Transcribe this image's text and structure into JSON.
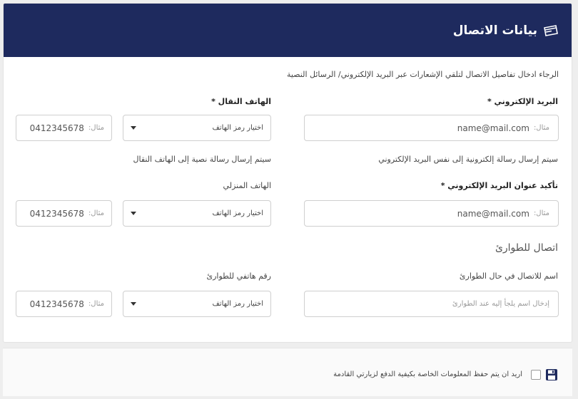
{
  "header": {
    "title": "بيانات الاتصال",
    "icon": "card-icon"
  },
  "intro": "الرجاء ادخال تفاصيل الاتصال لتلقي الإشعارات عبر البريد الإلكتروني/ الرسائل النصية",
  "email": {
    "label": "البريد الإلكتروني *",
    "placeholder_prefix": "مثال:",
    "placeholder_value": "name@mail.com",
    "hint": "سيتم إرسال رسالة إلكترونية إلى نفس البريد الإلكتروني"
  },
  "confirm_email": {
    "label": "تأكيد عنوان البريد الإلكتروني *",
    "placeholder_prefix": "مثال:",
    "placeholder_value": "name@mail.com"
  },
  "mobile": {
    "label": "الهاتف النقال *",
    "select_label": "اختيار رمز الهاتف",
    "placeholder_prefix": "مثال:",
    "placeholder_value": "0412345678",
    "hint": "سيتم إرسال رسالة نصية إلى الهاتف النقال"
  },
  "home_phone": {
    "label": "الهاتف المنزلي",
    "select_label": "اختيار رمز الهاتف",
    "placeholder_prefix": "مثال:",
    "placeholder_value": "0412345678"
  },
  "emergency": {
    "section_title": "اتصال للطوارئ",
    "name_label": "اسم للاتصال في حال الطوارئ",
    "name_placeholder": "إدخال اسم يلجأ إليه عند الطوارئ",
    "phone_label": "رقم هاتفي للطوارئ",
    "select_label": "اختيار رمز الهاتف",
    "placeholder_prefix": "مثال:",
    "placeholder_value": "0412345678"
  },
  "footer": {
    "save_text": "اريد ان يتم حفظ المعلومات الخاصة بكيفية الدفع لزيارتي القادمة",
    "save_icon": "floppy-disk-icon"
  },
  "colors": {
    "header_bg": "#1e2a5e",
    "page_bg": "#eeeeee"
  }
}
